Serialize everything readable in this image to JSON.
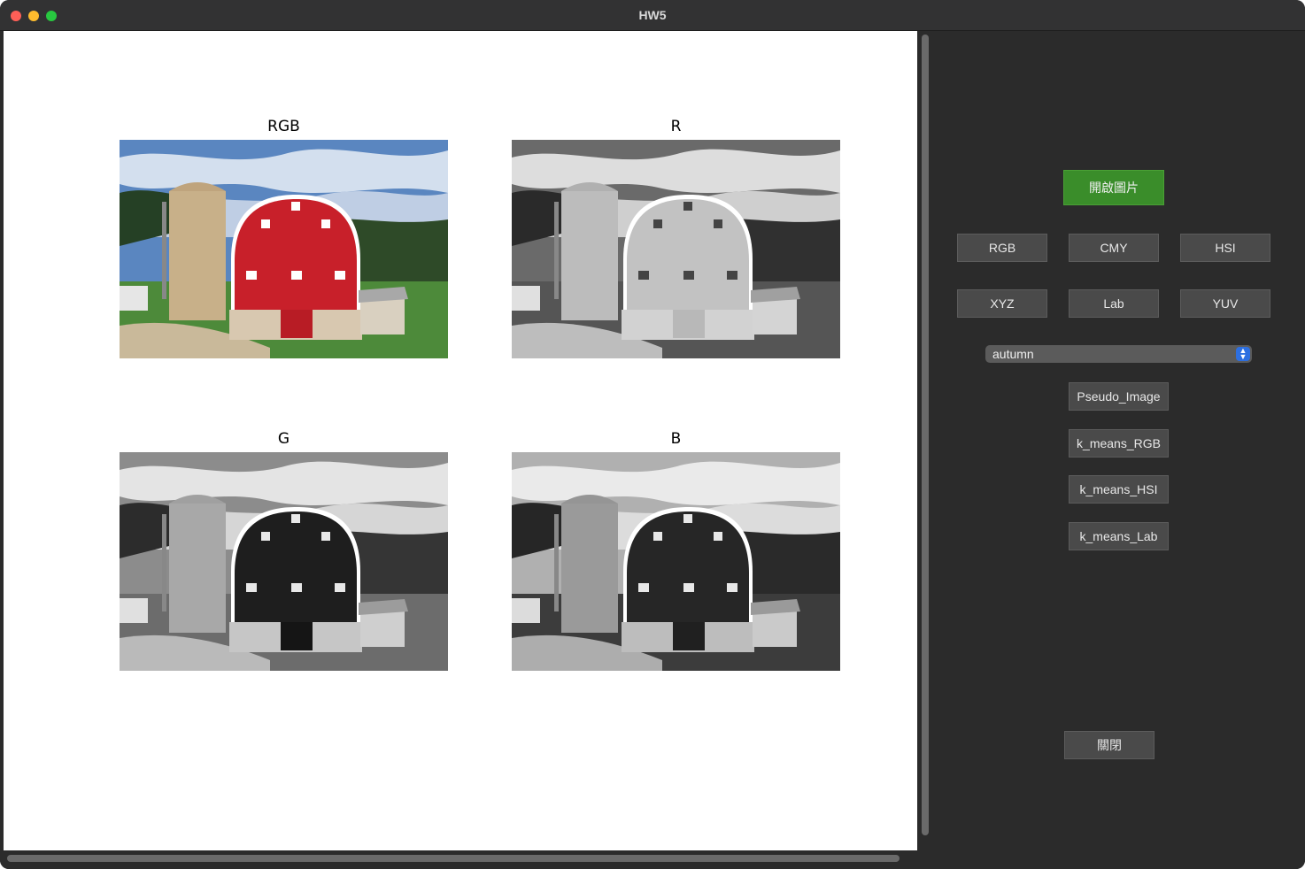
{
  "window": {
    "title": "HW5"
  },
  "plots": [
    {
      "title": "RGB",
      "mode": "color"
    },
    {
      "title": "R",
      "mode": "gray-r"
    },
    {
      "title": "G",
      "mode": "gray-g"
    },
    {
      "title": "B",
      "mode": "gray-b"
    }
  ],
  "panel": {
    "open_image_label": "開啟圖片",
    "color_buttons": [
      "RGB",
      "CMY",
      "HSI",
      "XYZ",
      "Lab",
      "YUV"
    ],
    "colormap_selected": "autumn",
    "pseudo_label": "Pseudo_Image",
    "kmeans_rgb_label": "k_means_RGB",
    "kmeans_hsi_label": "k_means_HSI",
    "kmeans_lab_label": "k_means_Lab",
    "close_label": "關閉"
  },
  "colors": {
    "accent_green": "#3a8d2a",
    "barn_red": "#c8202a",
    "panel_bg": "#2b2b2b"
  }
}
